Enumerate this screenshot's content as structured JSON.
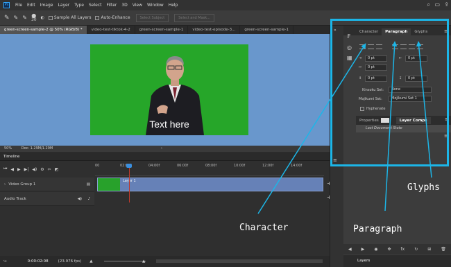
{
  "menubar": {
    "logo": "Ps",
    "items": [
      "File",
      "Edit",
      "Image",
      "Layer",
      "Type",
      "Select",
      "Filter",
      "3D",
      "View",
      "Window",
      "Help"
    ]
  },
  "options_bar": {
    "brush_size": "30",
    "sample_all_layers": "Sample All Layers",
    "auto_enhance": "Auto-Enhance",
    "select_subject": "Select Subject",
    "select_and_mask": "Select and Mask..."
  },
  "doc_tabs": [
    "green-screen-sample-2 @ 50% (RGB/8) *",
    "video-test-tiktok-4-2",
    "green-screen-sample-1",
    "video-test-episode-3...",
    "green-screen-sample-1"
  ],
  "canvas": {
    "overlay_text": "Text here",
    "zoom": "50%",
    "doc_info": "Doc: 1.29M/1.29M"
  },
  "timeline": {
    "title": "Timeline",
    "ruler": [
      "00",
      "02:00f",
      "04:00f",
      "06:00f",
      "08:00f",
      "10:00f",
      "12:00f",
      "14:00f"
    ],
    "video_group": "Video Group 1",
    "layer_clip": "Layer 1",
    "audio_track": "Audio Track",
    "timecode": "0:00:02:08",
    "fps": "(23.976 fps)"
  },
  "panel": {
    "tabs": [
      "Character",
      "Paragraph",
      "Glyphs"
    ],
    "indent_left": "0 pt",
    "indent_right": "0 pt",
    "indent_first": "0 pt",
    "space_before": "0 pt",
    "space_after": "0 pt",
    "kinsoku_label": "Kinsoku Set:",
    "kinsoku_value": "None",
    "mojikumi_label": "Mojikumi Set:",
    "mojikumi_value": "Mojikumi Set 1",
    "hyphenate": "Hyphenate"
  },
  "lower_panel": {
    "tabs": [
      "Properties",
      "Layer Comps"
    ],
    "item": "Last Document State"
  },
  "layers_tab": "Layers",
  "annotations": {
    "character": "Character",
    "paragraph": "Paragraph",
    "glyphs": "Glyphs"
  },
  "colors": {
    "highlight": "#1cb6e8",
    "canvas_bg": "#6997cc",
    "green_screen": "#26a629"
  }
}
